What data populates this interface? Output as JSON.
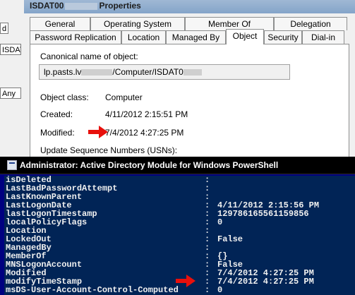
{
  "background_window": {
    "fragment_top": "d",
    "fragment_mid": "ISDAT",
    "fragment_any": "Any"
  },
  "dialog": {
    "title_prefix": "ISDAT00",
    "title_suffix": "Properties",
    "tabs_row1": [
      "General",
      "Operating System",
      "Member Of",
      "Delegation"
    ],
    "tabs_row2": [
      "Password Replication",
      "Location",
      "Managed By",
      "Object",
      "Security",
      "Dial-in"
    ],
    "selected_tab": "Object",
    "canonical_label": "Canonical name of object:",
    "canonical_prefix": "lp.pasts.lv",
    "canonical_suffix": "/Computer/ISDAT0",
    "object_class_label": "Object class:",
    "object_class_value": "Computer",
    "created_label": "Created:",
    "created_value": "4/11/2012 2:15:51 PM",
    "modified_label": "Modified:",
    "modified_value": "7/4/2012 4:27:25 PM",
    "usn_label": "Update Sequence Numbers (USNs):"
  },
  "powershell": {
    "title": "Administrator: Active Directory Module for Windows PowerShell",
    "rows": [
      {
        "key": "isDeleted",
        "value": ""
      },
      {
        "key": "LastBadPasswordAttempt",
        "value": ""
      },
      {
        "key": "LastKnownParent",
        "value": ""
      },
      {
        "key": "LastLogonDate",
        "value": "4/11/2012 2:15:56 PM"
      },
      {
        "key": "lastLogonTimestamp",
        "value": "129786165561159856"
      },
      {
        "key": "localPolicyFlags",
        "value": "0"
      },
      {
        "key": "Location",
        "value": ""
      },
      {
        "key": "LockedOut",
        "value": "False"
      },
      {
        "key": "ManagedBy",
        "value": ""
      },
      {
        "key": "MemberOf",
        "value": "{}"
      },
      {
        "key": "MNSLogonAccount",
        "value": "False"
      },
      {
        "key": "Modified",
        "value": "7/4/2012 4:27:25 PM"
      },
      {
        "key": "modifyTimeStamp",
        "value": "7/4/2012 4:27:25 PM"
      },
      {
        "key": "msDS-User-Account-Control-Computed",
        "value": "0"
      }
    ]
  },
  "colors": {
    "arrow": "#e8100c",
    "console_bg": "#012456",
    "console_text": "#f0f0f0"
  }
}
